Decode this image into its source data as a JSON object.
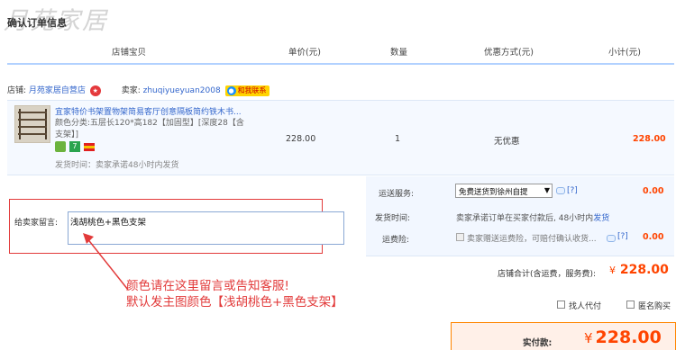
{
  "watermark": "月苑家居",
  "page_title": "确认订单信息",
  "table_header": {
    "shop_item": "店铺宝贝",
    "unit_price": "单价(元)",
    "quantity": "数量",
    "discount": "优惠方式(元)",
    "subtotal": "小计(元)"
  },
  "shop": {
    "label": "店铺:",
    "name": "月苑家居自营店",
    "seller_label": "卖家:",
    "seller_id": "zhuqiyueyuan2008",
    "contact_label": "和我联系"
  },
  "item": {
    "title": "宜家特价书架置物架简易客厅创意隔板简约铁木书...",
    "sku_line1": "颜色分类:五层长120*高182【加固型】[深度28【含",
    "sku_line2": "支架】]",
    "ship_note": "发货时间：卖家承诺48小时内发货",
    "unit_price": "228.00",
    "quantity": "1",
    "discount": "无优惠",
    "subtotal": "228.00"
  },
  "shipping": {
    "label": "运送服务:",
    "selected": "免费送货到徐州自提 ",
    "fee": "0.00"
  },
  "delivery": {
    "label": "发货时间:",
    "text": "卖家承诺订单在买家付款后, 48小时内",
    "link": "发货"
  },
  "insurance": {
    "label": "运费险:",
    "text": "卖家赠送运费险，可赔付确认收货...",
    "fee": "0.00"
  },
  "help_link": "[?]",
  "message": {
    "label": "给卖家留言:",
    "value": "浅胡桃色+黑色支架"
  },
  "shop_total": {
    "label": "店铺合计(含运费，服务费):",
    "currency": "¥",
    "amount": "228.00"
  },
  "annotation": {
    "line1": "颜色请在这里留言或告知客服!",
    "line2": "默认发主图颜色【浅胡桃色+黑色支架】"
  },
  "options": {
    "pay_for_me": "找人代付",
    "anonymous": "匿名购买"
  },
  "payment": {
    "label": "实付款:",
    "currency": "¥",
    "amount": "228.00"
  },
  "colors": {
    "accent_orange": "#ff4400",
    "link_blue": "#3366cc",
    "annotation_red": "#e23a3a",
    "header_line": "#b2d1ff"
  }
}
